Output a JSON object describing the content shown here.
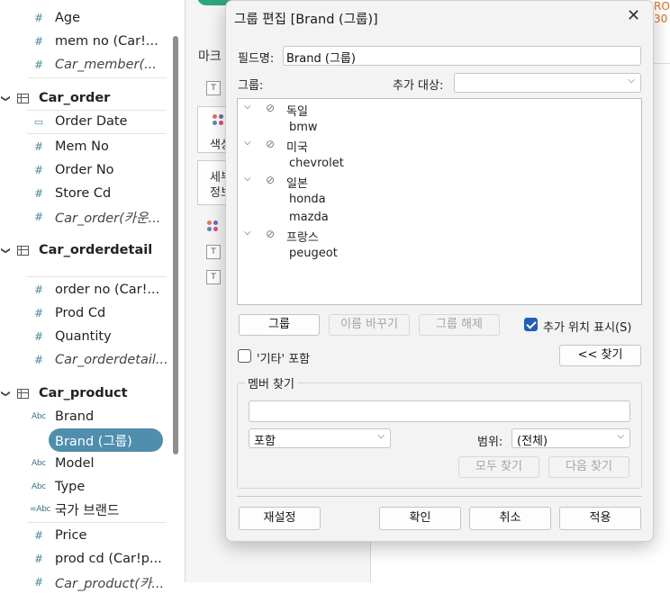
{
  "data_pane": {
    "items": [
      {
        "type": "field",
        "icon": "#",
        "label": "Age",
        "italic": false
      },
      {
        "type": "field",
        "icon": "#",
        "label": "mem no (Car!...",
        "italic": false
      },
      {
        "type": "field",
        "icon": "#",
        "label": "Car_member(...",
        "italic": true
      },
      {
        "type": "table",
        "label": "Car_order"
      },
      {
        "type": "field",
        "icon": "date",
        "label": "Order Date",
        "italic": false
      },
      {
        "type": "field",
        "icon": "#",
        "label": "Mem No",
        "italic": false
      },
      {
        "type": "field",
        "icon": "#",
        "label": "Order No",
        "italic": false
      },
      {
        "type": "field",
        "icon": "#",
        "label": "Store Cd",
        "italic": false
      },
      {
        "type": "field",
        "icon": "#",
        "label": "Car_order(카운...",
        "italic": true
      },
      {
        "type": "table",
        "label": "Car_orderdetail"
      },
      {
        "type": "field",
        "icon": "#",
        "label": "order no (Car!...",
        "italic": false
      },
      {
        "type": "field",
        "icon": "#",
        "label": "Prod Cd",
        "italic": false
      },
      {
        "type": "field",
        "icon": "#",
        "label": "Quantity",
        "italic": false
      },
      {
        "type": "field",
        "icon": "#",
        "label": "Car_orderdetail...",
        "italic": true
      },
      {
        "type": "table",
        "label": "Car_product"
      },
      {
        "type": "field",
        "icon": "Abc",
        "label": "Brand",
        "italic": false
      },
      {
        "type": "field",
        "icon": "clip",
        "label": "Brand (그룹)",
        "italic": false,
        "selected": true
      },
      {
        "type": "field",
        "icon": "Abc",
        "label": "Model",
        "italic": false
      },
      {
        "type": "field",
        "icon": "Abc",
        "label": "Type",
        "italic": false
      },
      {
        "type": "field",
        "icon": "=Abc",
        "label": "국가 브랜드",
        "italic": false
      },
      {
        "type": "field",
        "icon": "#",
        "label": "Price",
        "italic": false
      },
      {
        "type": "field",
        "icon": "#",
        "label": "prod cd (Car!p...",
        "italic": false
      },
      {
        "type": "field",
        "icon": "#",
        "label": "Car_product(카...",
        "italic": true
      }
    ],
    "icons": {
      "#": "#",
      "Abc": "Abc",
      "=Abc": "=Abc",
      "date": "▭",
      "clip": "⊘"
    }
  },
  "marks_card": {
    "title_partial": "마크",
    "color_partial": "색상",
    "detail_partial": "세부",
    "detail_partial2": "정보",
    "text_icon": "T"
  },
  "right_edge_text": [
    "RO",
    "30"
  ],
  "dialog": {
    "title": "그룹 편집 [Brand (그룹)]",
    "close_icon": "✕",
    "field_name_label": "필드명:",
    "field_name_value": "Brand (그룹)",
    "groups_label": "그룹:",
    "add_to_label": "추가 대상:",
    "add_to_value": "",
    "groups": [
      {
        "name": "독일",
        "members": [
          "bmw"
        ]
      },
      {
        "name": "미국",
        "members": [
          "chevrolet"
        ]
      },
      {
        "name": "일본",
        "members": [
          "honda",
          "mazda"
        ]
      },
      {
        "name": "프랑스",
        "members": [
          "peugeot"
        ]
      }
    ],
    "buttons": {
      "group": "그룹",
      "rename": "이름 바꾸기",
      "ungroup": "그룹 해제",
      "find": "<< 찾기",
      "find_all": "모두 찾기",
      "find_next": "다음 찾기",
      "reset": "재설정",
      "ok": "확인",
      "cancel": "취소",
      "apply": "적용"
    },
    "show_add_location_label": "추가 위치 표시(S)",
    "show_add_location_checked": true,
    "include_other_label": "'기타' 포함",
    "include_other_checked": false,
    "find_members_title": "멤버 찾기",
    "search_value": "",
    "match_mode_value": "포함",
    "range_label": "범위:",
    "range_value": "(전체)"
  }
}
